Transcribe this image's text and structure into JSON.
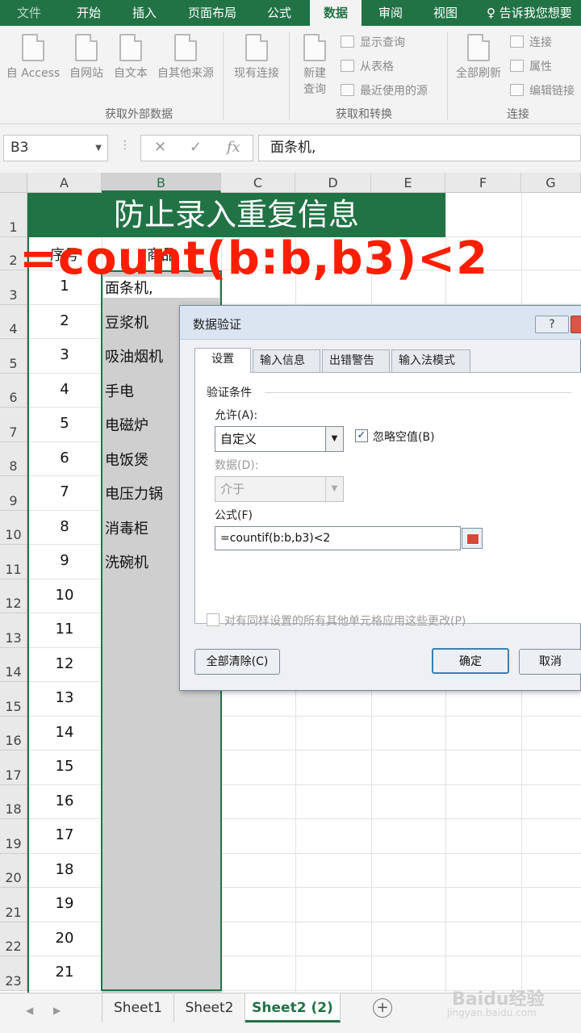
{
  "ribbon": {
    "tabs": [
      "文件",
      "开始",
      "插入",
      "页面布局",
      "公式",
      "数据",
      "审阅",
      "视图"
    ],
    "active_tab": "数据",
    "tell": "告诉我您想要",
    "buttons": [
      "自 Access",
      "自网站",
      "自文本",
      "自其他来源",
      "现有连接"
    ],
    "new_query": [
      "新建",
      "查询"
    ],
    "query_items": [
      "显示查询",
      "从表格",
      "最近使用的源"
    ],
    "refresh": "全部刷新",
    "conn_items": [
      "连接",
      "属性",
      "编辑链接"
    ],
    "groups": [
      "获取外部数据",
      "获取和转换",
      "连接"
    ]
  },
  "formula_bar": {
    "name_box": "B3",
    "fx": "fx",
    "cancel": "✕",
    "enter": "✓",
    "content": "面条机,"
  },
  "columns": [
    "A",
    "B",
    "C",
    "D",
    "E",
    "F",
    "G"
  ],
  "rows": [
    "1",
    "2",
    "3",
    "4",
    "5",
    "6",
    "7",
    "8",
    "9",
    "10",
    "11",
    "12",
    "13",
    "14",
    "15",
    "16",
    "17",
    "18",
    "19",
    "20",
    "21",
    "22",
    "23"
  ],
  "sheet": {
    "title": "防止录入重复信息",
    "header_a": "序号",
    "header_b": "商品",
    "seq": [
      "1",
      "2",
      "3",
      "4",
      "5",
      "6",
      "7",
      "8",
      "9",
      "10",
      "11",
      "12",
      "13",
      "14",
      "15",
      "16",
      "17",
      "18",
      "19",
      "20",
      "21"
    ],
    "items": [
      "面条机,",
      "豆浆机",
      "吸油烟机",
      "手电",
      "电磁炉",
      "电饭煲",
      "电压力锅",
      "消毒柜",
      "洗碗机"
    ]
  },
  "overlay_formula": "=count(b:b,b3)<2",
  "dialog": {
    "title": "数据验证",
    "help": "?",
    "tabs": [
      "设置",
      "输入信息",
      "出错警告",
      "输入法模式"
    ],
    "section": "验证条件",
    "allow_label": "允许(A):",
    "allow_value": "自定义",
    "ignore_blank": "忽略空值(B)",
    "ignore_checked": "✓",
    "data_label": "数据(D):",
    "data_value": "介于",
    "formula_label": "公式(F)",
    "formula_value": "=countif(b:b,b3)<2",
    "apply_all": "对有同样设置的所有其他单元格应用这些更改(P)",
    "clear_all": "全部清除(C)",
    "ok": "确定",
    "cancel": "取消"
  },
  "sheet_tabs": [
    "Sheet1",
    "Sheet2",
    "Sheet2 (2)"
  ],
  "active_sheet": "Sheet2 (2)",
  "watermark": {
    "logo": "Baidu经验",
    "url": "jingyan.baidu.com"
  }
}
